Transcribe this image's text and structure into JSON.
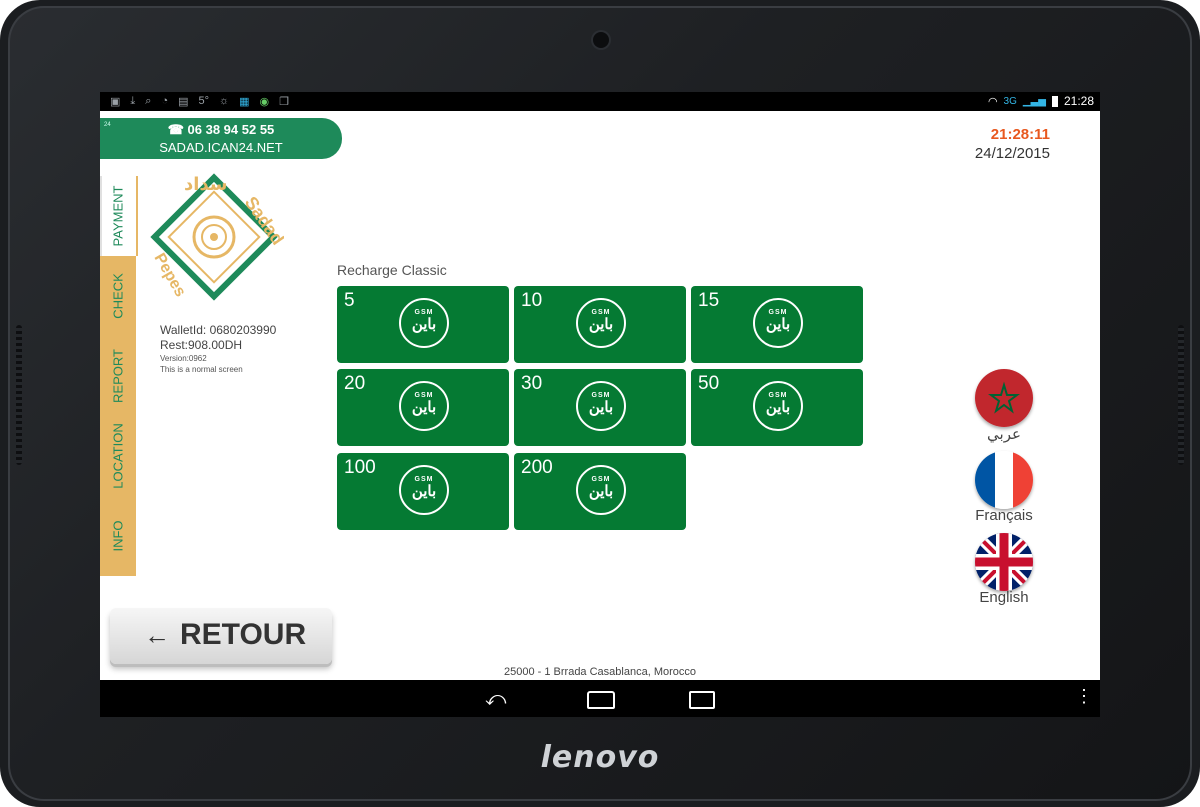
{
  "device": {
    "brand": "lenovo"
  },
  "statusbar": {
    "left_icons": [
      "image-icon",
      "download-icon",
      "search-icon",
      "alarm-icon",
      "photo-icon",
      "weather-icon",
      "calendar-icon",
      "badge-icon",
      "gallery-icon"
    ],
    "temperature": "5°",
    "network": "3G",
    "time": "21:28"
  },
  "header": {
    "contact_small": "24",
    "phone_icon": "☎",
    "phone": "06 38 94 52 55",
    "site": "SADAD.ICAN24.NET",
    "clock": "21:28:11",
    "date": "24/12/2015"
  },
  "sidebar": {
    "tabs": [
      {
        "label": "PAYMENT",
        "active": true
      },
      {
        "label": "CHECK",
        "active": false
      },
      {
        "label": "REPORT",
        "active": false
      },
      {
        "label": "LOCATION",
        "active": false
      },
      {
        "label": "INFO",
        "active": false
      }
    ]
  },
  "logo": {
    "top": "Sadad",
    "bottom": "Pepes",
    "arabic": "سداد"
  },
  "wallet": {
    "id": "WalletId: 0680203990",
    "rest": "Rest:908.00DH",
    "version": "Version:0962",
    "note": "This is a normal screen"
  },
  "main": {
    "title": "Recharge Classic",
    "operator_logo": {
      "top": "GSM",
      "arabic": "باين"
    },
    "tiles": [
      "5",
      "10",
      "15",
      "20",
      "30",
      "50",
      "100",
      "200"
    ]
  },
  "languages": [
    {
      "label": "عربي",
      "flag": "morocco"
    },
    {
      "label": "Français",
      "flag": "france"
    },
    {
      "label": "English",
      "flag": "uk"
    }
  ],
  "retour": {
    "arrow": "←",
    "label": "RETOUR"
  },
  "footer": {
    "address": "25000 - 1 Brrada Casablanca, Morocco"
  },
  "colors": {
    "green": "#057a33",
    "contact_green": "#1e8a5a",
    "gold": "#e6b765",
    "clock_orange": "#e8581f"
  }
}
